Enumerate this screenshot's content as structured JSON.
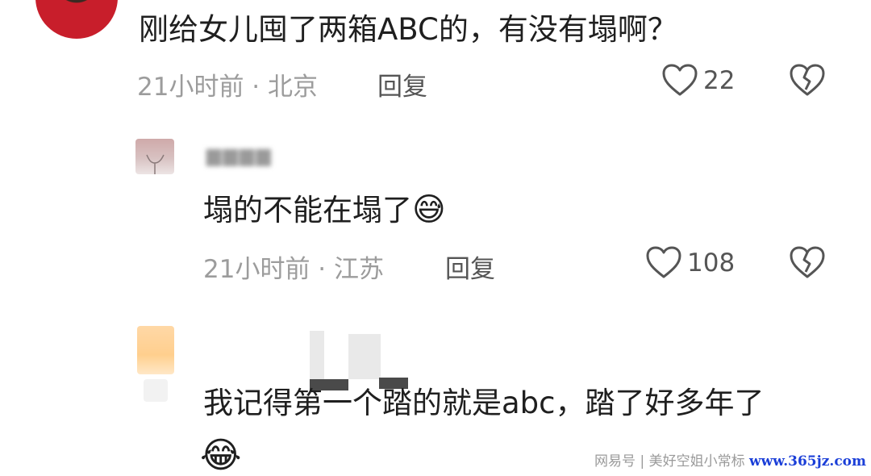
{
  "comments": [
    {
      "text": "刚给女儿囤了两箱ABC的，有没有塌啊？",
      "time_location": "21小时前 · 北京",
      "reply_label": "回复",
      "likes": "22"
    },
    {
      "text": "塌的不能在塌了",
      "emoji": "😅",
      "time_location": "21小时前 · 江苏",
      "reply_label": "回复",
      "likes": "108"
    },
    {
      "text": "我记得第一个踏的就是abc，踏了好多年了",
      "emoji": "😂"
    }
  ],
  "watermark": {
    "prefix": "网易号 | 美好空姐小常标",
    "site": "www.365jz.com"
  },
  "icons": {
    "like": "heart-outline-icon",
    "dislike": "broken-heart-icon"
  }
}
